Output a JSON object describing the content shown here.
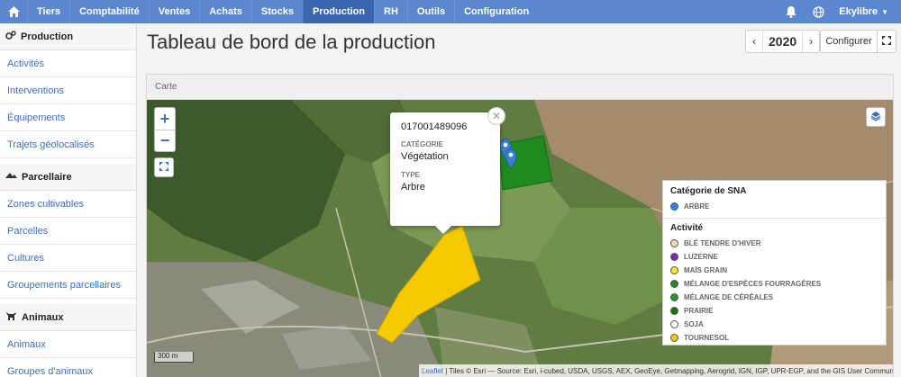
{
  "topbar": {
    "home_icon": "home-icon",
    "items": [
      {
        "label": "Tiers",
        "active": false
      },
      {
        "label": "Comptabilité",
        "active": false
      },
      {
        "label": "Ventes",
        "active": false
      },
      {
        "label": "Achats",
        "active": false
      },
      {
        "label": "Stocks",
        "active": false
      },
      {
        "label": "Production",
        "active": true
      },
      {
        "label": "RH",
        "active": false
      },
      {
        "label": "Outils",
        "active": false
      },
      {
        "label": "Configuration",
        "active": false
      }
    ],
    "user": "Ekylibre",
    "accent": "#5b87cf",
    "active_color": "#3a66b0"
  },
  "sidebar": {
    "sections": [
      {
        "title": "Production",
        "icon": "gears-icon",
        "items": [
          "Activités",
          "Interventions",
          "Équipements",
          "Trajets géolocalisés"
        ]
      },
      {
        "title": "Parcellaire",
        "icon": "land-icon",
        "items": [
          "Zones cultivables",
          "Parcelles",
          "Cultures",
          "Groupements parcellaires"
        ]
      },
      {
        "title": "Animaux",
        "icon": "cow-icon",
        "items": [
          "Animaux",
          "Groupes d'animaux"
        ]
      }
    ]
  },
  "main": {
    "title": "Tableau de bord de la production",
    "year": "2020",
    "configure_label": "Configurer"
  },
  "panel": {
    "title": "Carte"
  },
  "map": {
    "popup": {
      "id": "017001489096",
      "category_label": "CATÉGORIE",
      "category_value": "Végétation",
      "type_label": "TYPE",
      "type_value": "Arbre"
    },
    "legend": {
      "sna_title": "Catégorie de SNA",
      "sna_items": [
        {
          "label": "ARBRE",
          "color": "#3d7fd0"
        }
      ],
      "activity_title": "Activité",
      "activity_items": [
        {
          "label": "BLÉ TENDRE D'HIVER",
          "color": "#f5d7a8"
        },
        {
          "label": "LUZERNE",
          "color": "#8a1fbf"
        },
        {
          "label": "MAÏS GRAIN",
          "color": "#f0f000"
        },
        {
          "label": "MÉLANGE D'ESPÈCES FOURRAGÈRES",
          "color": "#1f8a1f"
        },
        {
          "label": "MÉLANGE DE CÉRÉALES",
          "color": "#1f9a2a"
        },
        {
          "label": "PRAIRIE",
          "color": "#0f7a0f"
        },
        {
          "label": "SOJA",
          "color": "#ffffff"
        },
        {
          "label": "TOURNESOL",
          "color": "#f5c800"
        }
      ]
    },
    "scale": "300 m",
    "attribution_link": "Leaflet",
    "attribution": " | Tiles © Esri — Source: Esri, i-cubed, USDA, USGS, AEX, GeoEye, Getmapping, Aerogrid, IGN, IGP, UPR-EGP, and the GIS User Community"
  }
}
